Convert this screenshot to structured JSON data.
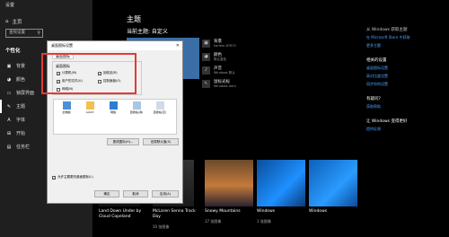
{
  "app": {
    "title": "设置"
  },
  "sidebar": {
    "home": "主页",
    "search_placeholder": "查找设置",
    "section": "个性化",
    "items": [
      {
        "label": "背景",
        "icon": "picture-icon"
      },
      {
        "label": "颜色",
        "icon": "palette-icon"
      },
      {
        "label": "锁屏界面",
        "icon": "lock-screen-icon"
      },
      {
        "label": "主题",
        "icon": "brush-icon",
        "active": true
      },
      {
        "label": "字体",
        "icon": "font-icon"
      },
      {
        "label": "开始",
        "icon": "start-icon"
      },
      {
        "label": "任务栏",
        "icon": "taskbar-icon"
      }
    ]
  },
  "main": {
    "title": "主题",
    "current_theme": "当前主题: 自定义",
    "properties": [
      {
        "title": "背景",
        "sub": "harlem-87670"
      },
      {
        "title": "颜色",
        "sub": "默认蓝色"
      },
      {
        "title": "声音",
        "sub": "Windows 默认"
      },
      {
        "title": "鼠标光标",
        "sub": "Windows Aero"
      }
    ]
  },
  "right_panel": {
    "items": [
      "从 Windows 获取主题",
      "在 Microsoft Store 中获取",
      "更多主题"
    ],
    "related_heading": "相关的设置",
    "related_links": [
      "桌面图标设置",
      "高对比度设置",
      "同步你的设置"
    ],
    "question_heading": "有疑问?",
    "question_link": "获取帮助",
    "improve_heading": "让 Windows 变得更好",
    "improve_link": "提供反馈"
  },
  "themes": [
    {
      "name": "Land Down Under by Cloud Copeland",
      "count": ""
    },
    {
      "name": "McLaren Senna Track Day",
      "count": "10 张图像"
    },
    {
      "name": "Snowy Mountains",
      "count": "17 张图像"
    },
    {
      "name": "Windows",
      "count": "1 张图像"
    },
    {
      "name": "Windows",
      "count": ""
    }
  ],
  "dialog": {
    "title": "桌面图标设置",
    "tab": "桌面图标",
    "group_title": "桌面图标",
    "checkboxes": [
      {
        "label": "计算机(M)",
        "checked": true
      },
      {
        "label": "回收站(R)",
        "checked": true
      },
      {
        "label": "用户的文件(U)",
        "checked": true
      },
      {
        "label": "控制面板(O)",
        "checked": false
      },
      {
        "label": "网络(N)",
        "checked": false
      }
    ],
    "icons": [
      {
        "label": "此电脑",
        "icon": "computer-icon"
      },
      {
        "label": "Ai123",
        "icon": "user-folder-icon"
      },
      {
        "label": "网络",
        "icon": "network-icon"
      },
      {
        "label": "回收站(满)",
        "icon": "recycle-bin-full-icon"
      },
      {
        "label": "回收站(空)",
        "icon": "recycle-bin-empty-icon"
      }
    ],
    "change_icon_btn": "更改图标(H)...",
    "restore_btn": "还原默认值(S)",
    "allow_label": "允许主题更改桌面图标(L)",
    "allow_checked": true,
    "ok": "确定",
    "cancel": "取消",
    "apply": "应用(A)"
  },
  "colors": {
    "accent": "#0078d7",
    "highlight": "#e53935"
  }
}
